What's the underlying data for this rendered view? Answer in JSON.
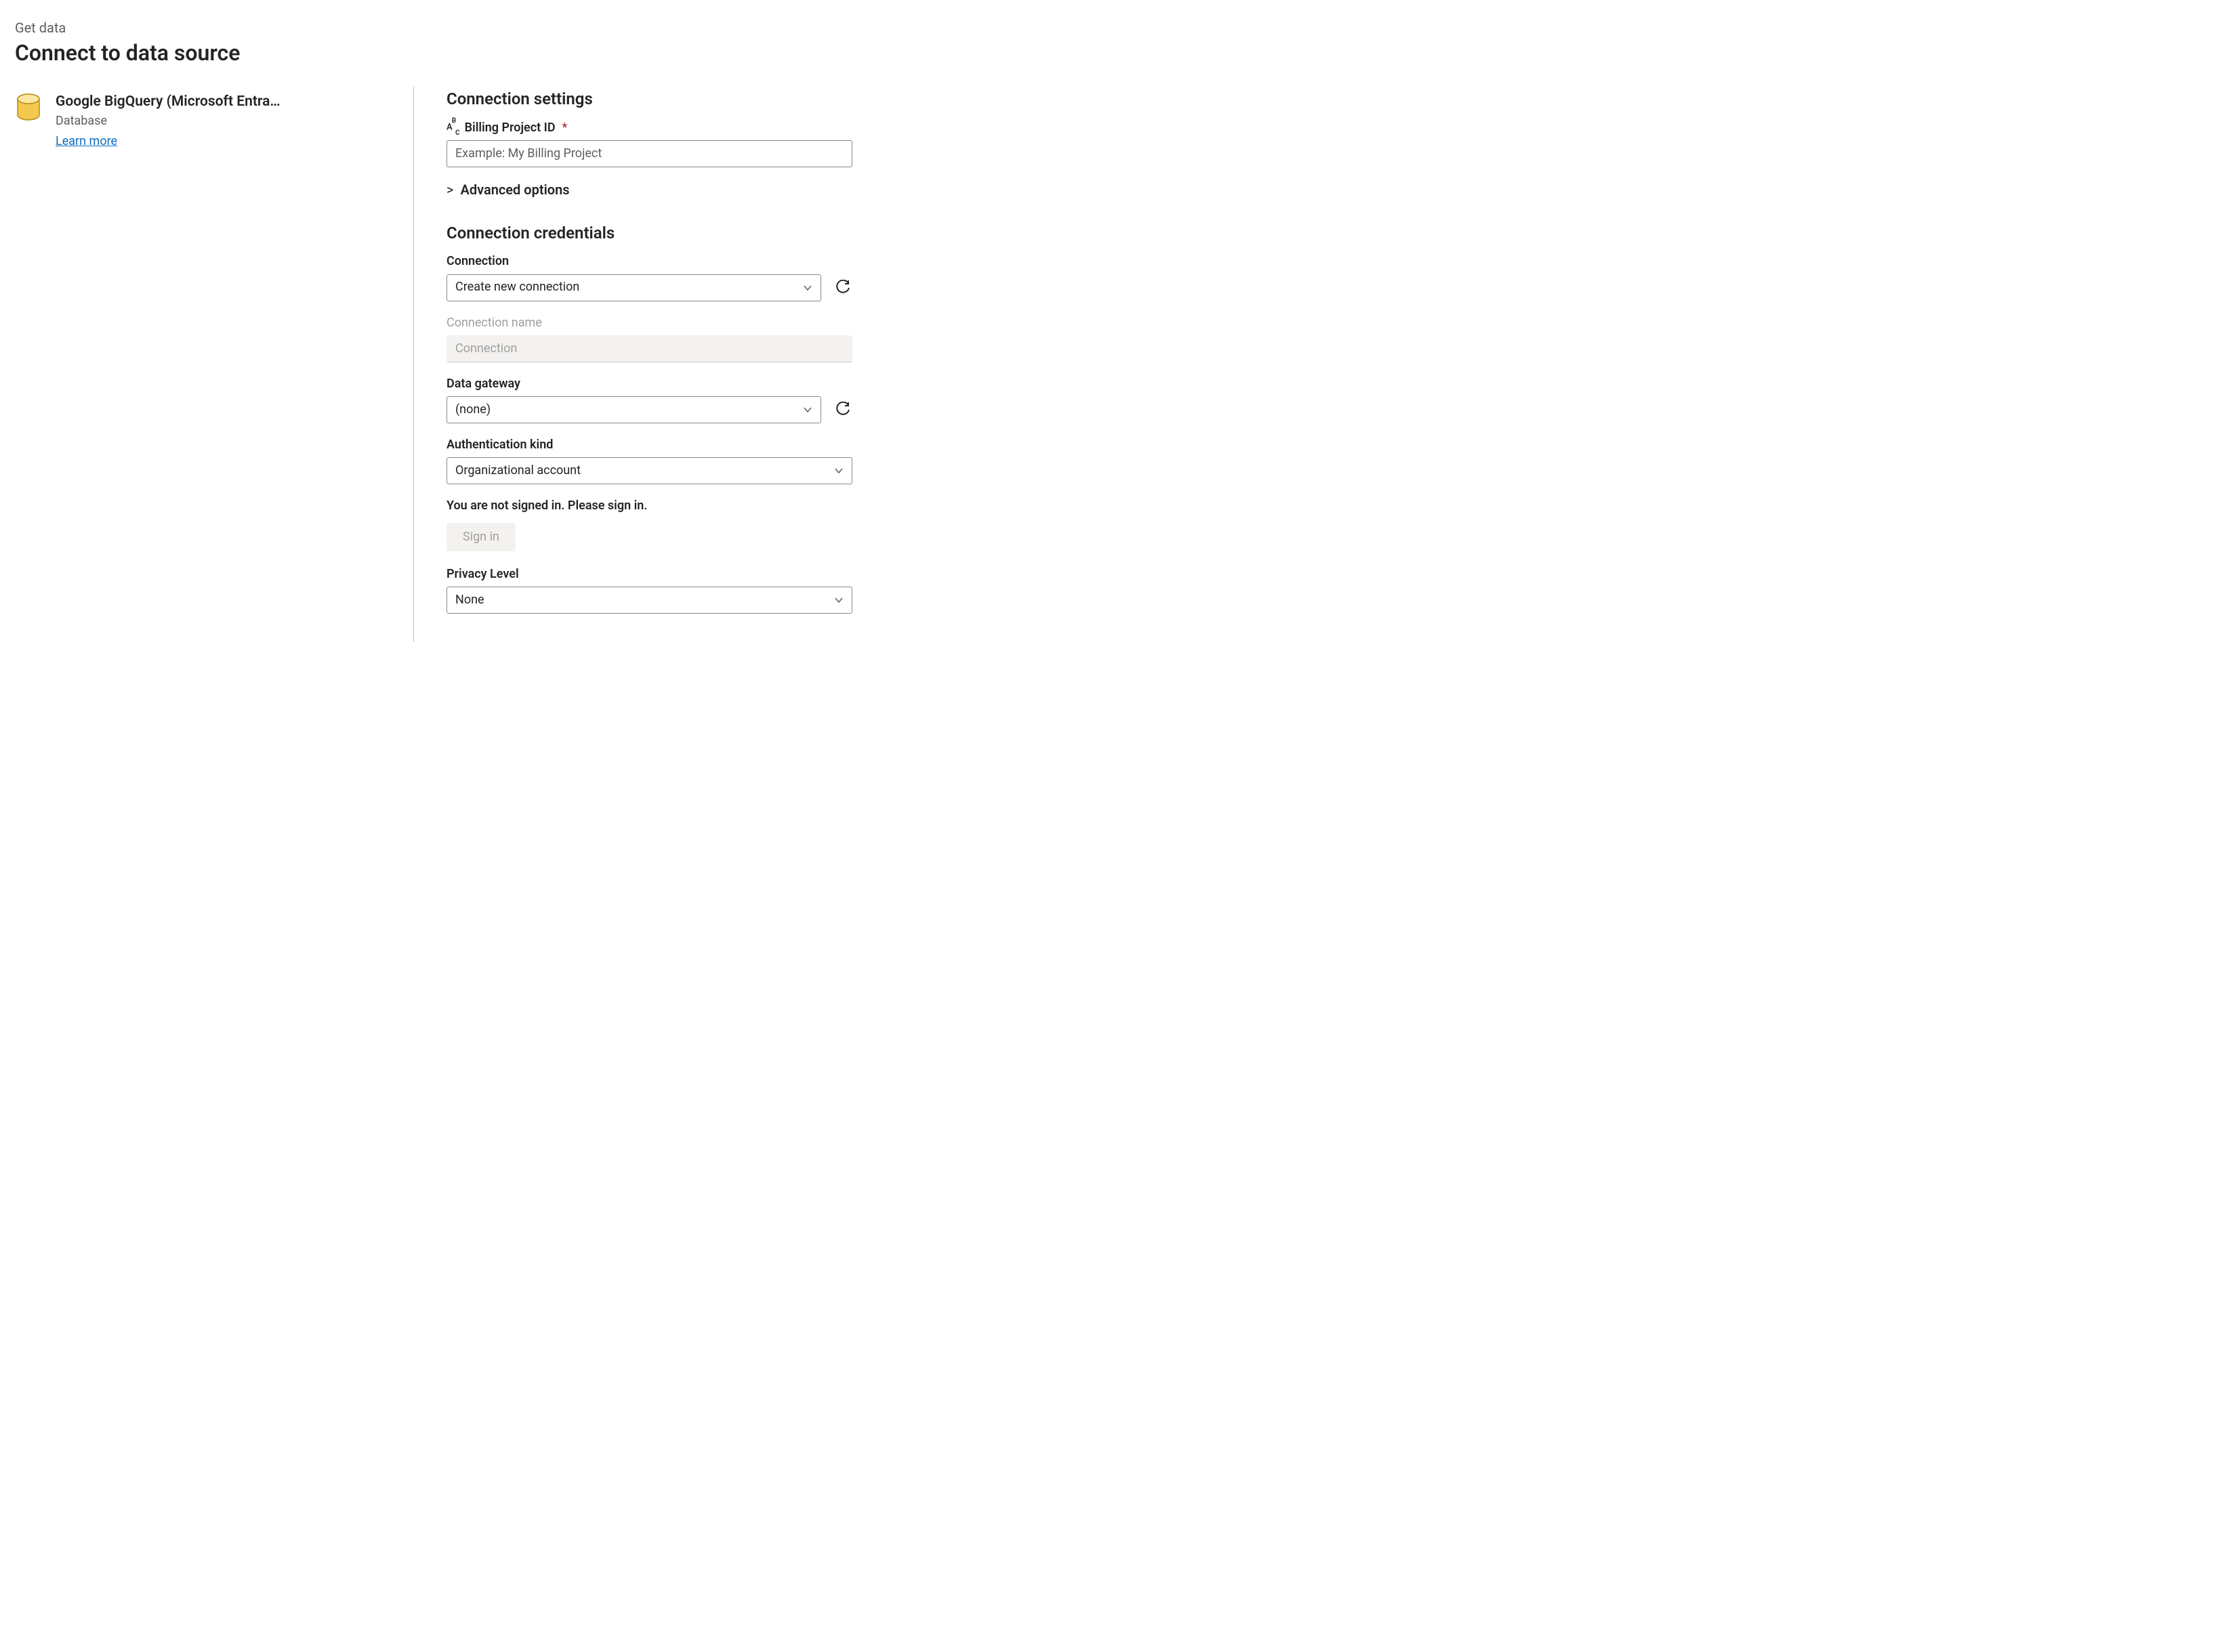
{
  "header": {
    "breadcrumb": "Get data",
    "title": "Connect to data source"
  },
  "source": {
    "name": "Google BigQuery (Microsoft Entra…",
    "category": "Database",
    "learn_more_label": "Learn more"
  },
  "settings": {
    "heading": "Connection settings",
    "billing_project": {
      "label": "Billing Project ID",
      "placeholder": "Example: My Billing Project",
      "value": ""
    },
    "advanced_label": "Advanced options"
  },
  "credentials": {
    "heading": "Connection credentials",
    "connection": {
      "label": "Connection",
      "value": "Create new connection"
    },
    "connection_name": {
      "label": "Connection name",
      "placeholder": "Connection",
      "value": ""
    },
    "data_gateway": {
      "label": "Data gateway",
      "value": "(none)"
    },
    "auth_kind": {
      "label": "Authentication kind",
      "value": "Organizational account"
    },
    "signin_message": "You are not signed in. Please sign in.",
    "signin_button": "Sign in",
    "privacy_level": {
      "label": "Privacy Level",
      "value": "None"
    }
  },
  "icons": {
    "chevron_right": ">",
    "required_marker": "*"
  }
}
